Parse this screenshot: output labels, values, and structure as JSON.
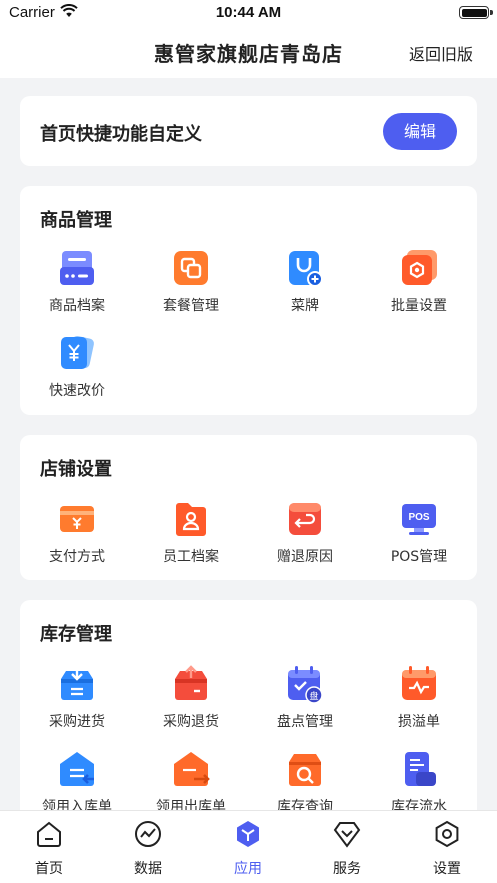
{
  "status_bar": {
    "carrier": "Carrier",
    "time": "10:44 AM"
  },
  "nav": {
    "title": "惠管家旗舰店青岛店",
    "right_action": "返回旧版"
  },
  "quick": {
    "title": "首页快捷功能自定义",
    "edit_label": "编辑"
  },
  "sections": {
    "goods": {
      "title": "商品管理",
      "items": [
        {
          "label": "商品档案",
          "icon": "product-file-icon"
        },
        {
          "label": "套餐管理",
          "icon": "package-icon"
        },
        {
          "label": "菜牌",
          "icon": "menu-board-icon"
        },
        {
          "label": "批量设置",
          "icon": "batch-settings-icon"
        },
        {
          "label": "快速改价",
          "icon": "quick-price-icon"
        }
      ]
    },
    "store": {
      "title": "店铺设置",
      "items": [
        {
          "label": "支付方式",
          "icon": "payment-icon"
        },
        {
          "label": "员工档案",
          "icon": "staff-file-icon"
        },
        {
          "label": "赠退原因",
          "icon": "return-reason-icon"
        },
        {
          "label": "POS管理",
          "icon": "pos-icon",
          "badge": "POS"
        }
      ]
    },
    "stock": {
      "title": "库存管理",
      "items": [
        {
          "label": "采购进货",
          "icon": "purchase-in-icon"
        },
        {
          "label": "采购退货",
          "icon": "purchase-return-icon"
        },
        {
          "label": "盘点管理",
          "icon": "stocktake-icon",
          "badge": "盘"
        },
        {
          "label": "损溢单",
          "icon": "loss-gain-icon"
        },
        {
          "label": "领用入库单",
          "icon": "warehouse-in-icon"
        },
        {
          "label": "领用出库单",
          "icon": "warehouse-out-icon"
        },
        {
          "label": "库存查询",
          "icon": "stock-query-icon"
        },
        {
          "label": "库存流水",
          "icon": "stock-flow-icon"
        }
      ]
    }
  },
  "tabs": [
    {
      "label": "首页",
      "icon": "home-icon"
    },
    {
      "label": "数据",
      "icon": "data-icon"
    },
    {
      "label": "应用",
      "icon": "apps-icon"
    },
    {
      "label": "服务",
      "icon": "service-icon"
    },
    {
      "label": "设置",
      "icon": "settings-icon"
    }
  ],
  "active_tab": "应用",
  "colors": {
    "accent": "#4e5ef0",
    "orange": "#ff6a2a",
    "blue": "#2f8bff",
    "red": "#f44d3c",
    "background": "#f2f3f5"
  }
}
